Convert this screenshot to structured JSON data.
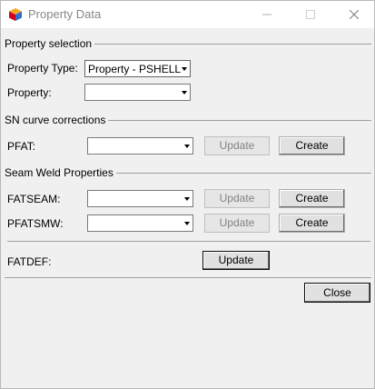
{
  "window": {
    "title": "Property Data",
    "controls": {
      "minimize_icon": "minimize-icon",
      "maximize_icon": "maximize-icon",
      "close_icon": "close-icon"
    }
  },
  "property_selection": {
    "section_label": "Property selection",
    "property_type_label": "Property Type:",
    "property_type_value": "Property - PSHELL",
    "property_label": "Property:",
    "property_value": ""
  },
  "sn_curve_corrections": {
    "section_label": "SN curve corrections",
    "pfat_label": "PFAT:",
    "pfat_value": "",
    "update_label": "Update",
    "create_label": "Create"
  },
  "seam_weld_properties": {
    "section_label": "Seam Weld Properties",
    "fatseam_label": "FATSEAM:",
    "fatseam_value": "",
    "fatseam_update_label": "Update",
    "fatseam_create_label": "Create",
    "pfatsmw_label": "PFATSMW:",
    "pfatsmw_value": "",
    "pfatsmw_update_label": "Update",
    "pfatsmw_create_label": "Create"
  },
  "fatdef": {
    "label": "FATDEF:",
    "update_label": "Update"
  },
  "footer": {
    "close_label": "Close"
  },
  "colors": {
    "titlebar_bg": "#ffffff",
    "dialog_bg": "#f0f0f0",
    "disabled_text": "#838383"
  }
}
